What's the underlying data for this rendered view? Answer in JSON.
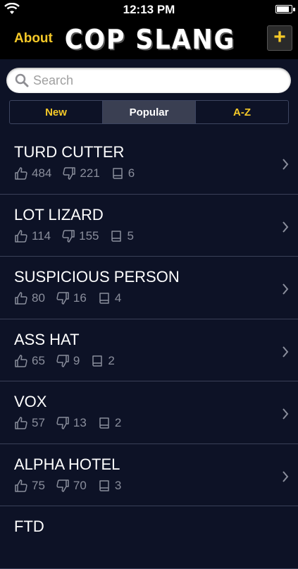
{
  "status_bar": {
    "time": "12:13 PM",
    "battery_level": 0.9
  },
  "nav": {
    "about_label": "About",
    "logo_text": "COP SLANG",
    "add_label": "+"
  },
  "search": {
    "placeholder": "Search",
    "value": ""
  },
  "segments": [
    {
      "label": "New",
      "selected": false
    },
    {
      "label": "Popular",
      "selected": true
    },
    {
      "label": "A-Z",
      "selected": false
    }
  ],
  "items": [
    {
      "title": "TURD CUTTER",
      "likes": "484",
      "dislikes": "221",
      "definitions": "6"
    },
    {
      "title": "LOT LIZARD",
      "likes": "114",
      "dislikes": "155",
      "definitions": "5"
    },
    {
      "title": "SUSPICIOUS PERSON",
      "likes": "80",
      "dislikes": "16",
      "definitions": "4"
    },
    {
      "title": "ASS HAT",
      "likes": "65",
      "dislikes": "9",
      "definitions": "2"
    },
    {
      "title": "VOX",
      "likes": "57",
      "dislikes": "13",
      "definitions": "2"
    },
    {
      "title": "ALPHA HOTEL",
      "likes": "75",
      "dislikes": "70",
      "definitions": "3"
    },
    {
      "title": "FTD",
      "likes": "",
      "dislikes": "",
      "definitions": ""
    }
  ],
  "colors": {
    "accent": "#f5c928",
    "background": "#0d1226",
    "bar": "#000000"
  },
  "icons": {
    "like": "thumbs-up-icon",
    "dislike": "thumbs-down-icon",
    "definitions": "book-icon",
    "disclosure": "chevron-right-icon"
  }
}
